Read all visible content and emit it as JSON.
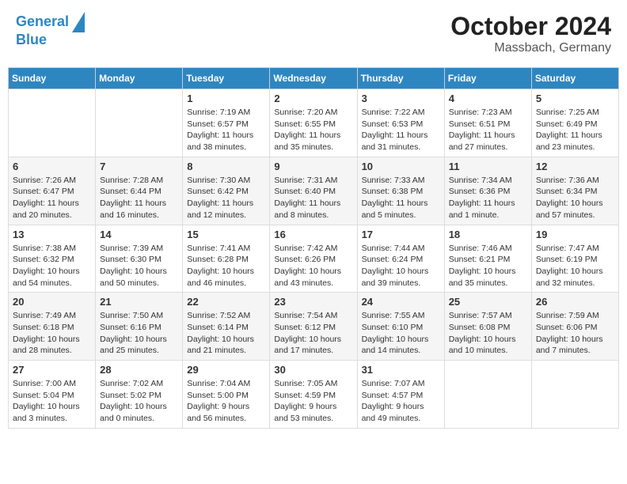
{
  "header": {
    "logo_line1": "General",
    "logo_line2": "Blue",
    "title": "October 2024",
    "subtitle": "Massbach, Germany"
  },
  "weekdays": [
    "Sunday",
    "Monday",
    "Tuesday",
    "Wednesday",
    "Thursday",
    "Friday",
    "Saturday"
  ],
  "weeks": [
    [
      null,
      null,
      {
        "day": 1,
        "sunrise": "7:19 AM",
        "sunset": "6:57 PM",
        "daylight": "11 hours and 38 minutes."
      },
      {
        "day": 2,
        "sunrise": "7:20 AM",
        "sunset": "6:55 PM",
        "daylight": "11 hours and 35 minutes."
      },
      {
        "day": 3,
        "sunrise": "7:22 AM",
        "sunset": "6:53 PM",
        "daylight": "11 hours and 31 minutes."
      },
      {
        "day": 4,
        "sunrise": "7:23 AM",
        "sunset": "6:51 PM",
        "daylight": "11 hours and 27 minutes."
      },
      {
        "day": 5,
        "sunrise": "7:25 AM",
        "sunset": "6:49 PM",
        "daylight": "11 hours and 23 minutes."
      }
    ],
    [
      {
        "day": 6,
        "sunrise": "7:26 AM",
        "sunset": "6:47 PM",
        "daylight": "11 hours and 20 minutes."
      },
      {
        "day": 7,
        "sunrise": "7:28 AM",
        "sunset": "6:44 PM",
        "daylight": "11 hours and 16 minutes."
      },
      {
        "day": 8,
        "sunrise": "7:30 AM",
        "sunset": "6:42 PM",
        "daylight": "11 hours and 12 minutes."
      },
      {
        "day": 9,
        "sunrise": "7:31 AM",
        "sunset": "6:40 PM",
        "daylight": "11 hours and 8 minutes."
      },
      {
        "day": 10,
        "sunrise": "7:33 AM",
        "sunset": "6:38 PM",
        "daylight": "11 hours and 5 minutes."
      },
      {
        "day": 11,
        "sunrise": "7:34 AM",
        "sunset": "6:36 PM",
        "daylight": "11 hours and 1 minute."
      },
      {
        "day": 12,
        "sunrise": "7:36 AM",
        "sunset": "6:34 PM",
        "daylight": "10 hours and 57 minutes."
      }
    ],
    [
      {
        "day": 13,
        "sunrise": "7:38 AM",
        "sunset": "6:32 PM",
        "daylight": "10 hours and 54 minutes."
      },
      {
        "day": 14,
        "sunrise": "7:39 AM",
        "sunset": "6:30 PM",
        "daylight": "10 hours and 50 minutes."
      },
      {
        "day": 15,
        "sunrise": "7:41 AM",
        "sunset": "6:28 PM",
        "daylight": "10 hours and 46 minutes."
      },
      {
        "day": 16,
        "sunrise": "7:42 AM",
        "sunset": "6:26 PM",
        "daylight": "10 hours and 43 minutes."
      },
      {
        "day": 17,
        "sunrise": "7:44 AM",
        "sunset": "6:24 PM",
        "daylight": "10 hours and 39 minutes."
      },
      {
        "day": 18,
        "sunrise": "7:46 AM",
        "sunset": "6:21 PM",
        "daylight": "10 hours and 35 minutes."
      },
      {
        "day": 19,
        "sunrise": "7:47 AM",
        "sunset": "6:19 PM",
        "daylight": "10 hours and 32 minutes."
      }
    ],
    [
      {
        "day": 20,
        "sunrise": "7:49 AM",
        "sunset": "6:18 PM",
        "daylight": "10 hours and 28 minutes."
      },
      {
        "day": 21,
        "sunrise": "7:50 AM",
        "sunset": "6:16 PM",
        "daylight": "10 hours and 25 minutes."
      },
      {
        "day": 22,
        "sunrise": "7:52 AM",
        "sunset": "6:14 PM",
        "daylight": "10 hours and 21 minutes."
      },
      {
        "day": 23,
        "sunrise": "7:54 AM",
        "sunset": "6:12 PM",
        "daylight": "10 hours and 17 minutes."
      },
      {
        "day": 24,
        "sunrise": "7:55 AM",
        "sunset": "6:10 PM",
        "daylight": "10 hours and 14 minutes."
      },
      {
        "day": 25,
        "sunrise": "7:57 AM",
        "sunset": "6:08 PM",
        "daylight": "10 hours and 10 minutes."
      },
      {
        "day": 26,
        "sunrise": "7:59 AM",
        "sunset": "6:06 PM",
        "daylight": "10 hours and 7 minutes."
      }
    ],
    [
      {
        "day": 27,
        "sunrise": "7:00 AM",
        "sunset": "5:04 PM",
        "daylight": "10 hours and 3 minutes."
      },
      {
        "day": 28,
        "sunrise": "7:02 AM",
        "sunset": "5:02 PM",
        "daylight": "10 hours and 0 minutes."
      },
      {
        "day": 29,
        "sunrise": "7:04 AM",
        "sunset": "5:00 PM",
        "daylight": "9 hours and 56 minutes."
      },
      {
        "day": 30,
        "sunrise": "7:05 AM",
        "sunset": "4:59 PM",
        "daylight": "9 hours and 53 minutes."
      },
      {
        "day": 31,
        "sunrise": "7:07 AM",
        "sunset": "4:57 PM",
        "daylight": "9 hours and 49 minutes."
      },
      null,
      null
    ]
  ]
}
